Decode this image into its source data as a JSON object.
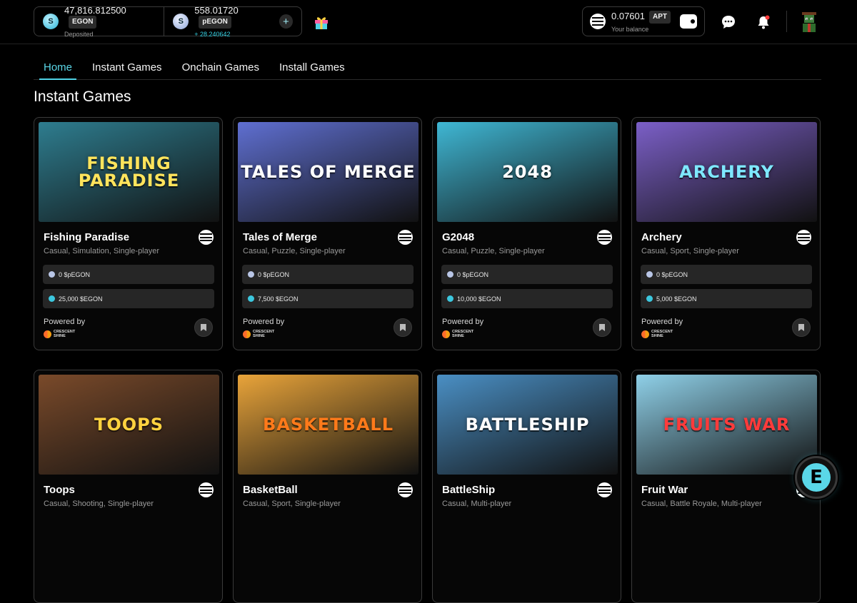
{
  "wallet": {
    "egon_amount": "47,816.812500",
    "egon_tag": "EGON",
    "egon_sub": "Deposited",
    "pegon_amount": "558.01720",
    "pegon_tag": "pEGON",
    "pegon_sub": "+ 28.240642",
    "add_symbol": "+"
  },
  "balance": {
    "amount": "0.07601",
    "tag": "APT",
    "sub": "Your balance"
  },
  "tabs": [
    {
      "label": "Home",
      "active": true
    },
    {
      "label": "Instant Games",
      "active": false
    },
    {
      "label": "Onchain Games",
      "active": false
    },
    {
      "label": "Install Games",
      "active": false
    }
  ],
  "section_title": "Instant Games",
  "cards": [
    {
      "title": "Fishing Paradise",
      "genres": "Casual, Simulation, Single-player",
      "pegon": "0 $pEGON",
      "egon": "25,000 $EGON",
      "powered": "Powered by",
      "studio": "CRESCENT SHINE",
      "logo": "FISHING PARADISE",
      "bg": "#2e7d8f",
      "logo_color": "#ffe45c"
    },
    {
      "title": "Tales of Merge",
      "genres": "Casual, Puzzle, Single-player",
      "pegon": "0 $pEGON",
      "egon": "7,500 $EGON",
      "powered": "Powered by",
      "studio": "CRESCENT SHINE",
      "logo": "TALES OF MERGE",
      "bg": "#5f6fd1",
      "logo_color": "#ffffff"
    },
    {
      "title": "G2048",
      "genres": "Casual, Puzzle, Single-player",
      "pegon": "0 $pEGON",
      "egon": "10,000 $EGON",
      "powered": "Powered by",
      "studio": "CRESCENT SHINE",
      "logo": "2048",
      "bg": "#3fb7d4",
      "logo_color": "#ffffff"
    },
    {
      "title": "Archery",
      "genres": "Casual, Sport, Single-player",
      "pegon": "0 $pEGON",
      "egon": "5,000 $EGON",
      "powered": "Powered by",
      "studio": "CRESCENT SHINE",
      "logo": "ARCHERY",
      "bg": "#7b5fc7",
      "logo_color": "#7ee8ff"
    },
    {
      "title": "Toops",
      "genres": "Casual, Shooting, Single-player",
      "logo": "TOOPS",
      "bg": "#7a4a2a",
      "logo_color": "#ffd23f"
    },
    {
      "title": "BasketBall",
      "genres": "Casual, Sport, Single-player",
      "logo": "BASKETBALL",
      "bg": "#e9a43a",
      "logo_color": "#ff7a1a"
    },
    {
      "title": "BattleShip",
      "genres": "Casual, Multi-player",
      "logo": "BATTLESHIP",
      "bg": "#4a8fc4",
      "logo_color": "#ffffff"
    },
    {
      "title": "Fruit War",
      "genres": "Casual, Battle Royale, Multi-player",
      "logo": "FRUITS WAR",
      "bg": "#8fd0e8",
      "logo_color": "#ff3b3b"
    }
  ]
}
